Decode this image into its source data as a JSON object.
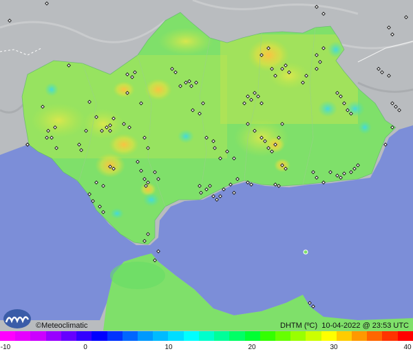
{
  "brand": {
    "copyright_text": "©Meteoclimatic",
    "logo_icon": "meteoclimatic-logo-icon"
  },
  "map": {
    "variable_label": "DHTM (ºC)",
    "timestamp": "10-04-2022 @ 23:53 UTC",
    "land_color": "#b9bcbf",
    "sea_color": "#7c8ed8",
    "region_base_color": "#7fe06a"
  },
  "legend": {
    "ticks": [
      "-10",
      "0",
      "10",
      "20",
      "30",
      "40"
    ],
    "colors": [
      "#ff00ff",
      "#e600ff",
      "#cc00ff",
      "#9900ff",
      "#6600ff",
      "#3300ff",
      "#0000ff",
      "#0033ff",
      "#0066ff",
      "#0099ff",
      "#00bbff",
      "#00ddff",
      "#00ffff",
      "#00ffcc",
      "#00ff99",
      "#00ff66",
      "#00ff33",
      "#33ff00",
      "#66ff00",
      "#99ff00",
      "#ccff00",
      "#ffff00",
      "#ffcc00",
      "#ff9900",
      "#ff6600",
      "#ff3300",
      "#ff0000"
    ]
  }
}
